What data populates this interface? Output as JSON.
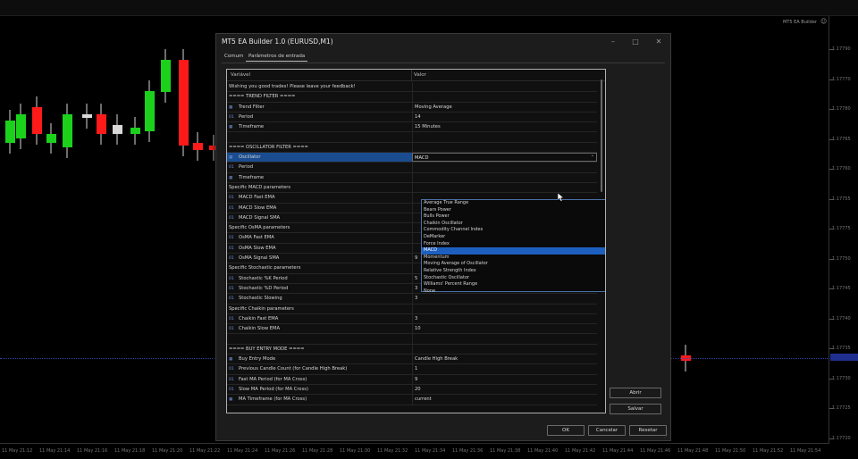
{
  "chart": {
    "label": "MT5 EA Builder",
    "price_ticks": [
      "1.17790",
      "1.17770",
      "1.17780",
      "1.17765",
      "1.17760",
      "1.17755",
      "1.17775",
      "1.17750",
      "1.17745",
      "1.17740",
      "1.17735",
      "1.17730",
      "1.17725",
      "1.17720"
    ],
    "time_ticks": [
      "11 May 21:12",
      "11 May 21:14",
      "11 May 21:16",
      "11 May 21:18",
      "11 May 21:20",
      "11 May 21:22",
      "11 May 21:24",
      "11 May 21:26",
      "11 May 21:28",
      "11 May 21:30",
      "11 May 21:32",
      "11 May 21:34",
      "11 May 21:36",
      "11 May 21:38",
      "11 May 21:40",
      "11 May 21:42",
      "11 May 21:44",
      "11 May 21:46",
      "11 May 21:48",
      "11 May 21:50",
      "11 May 21:52",
      "11 May 21:54"
    ],
    "colors": {
      "bull": "#1cd11c",
      "bear": "#ff1a1a",
      "bid_line": "#3344aa"
    }
  },
  "dialog": {
    "title": "MT5 EA Builder 1.0 (EURUSD,M1)",
    "tabs": [
      "Comum",
      "Parâmetros de entrada"
    ],
    "active_tab": "Parâmetros de entrada",
    "columns": {
      "variable": "Variável",
      "value": "Valor"
    },
    "rows": [
      {
        "name": "Wishing you good trades! Please leave your feedback!",
        "value": "",
        "icon": ""
      },
      {
        "name": "==== TREND FILTER ====",
        "value": "",
        "icon": ""
      },
      {
        "name": "Trend Filter",
        "value": "Moving Average",
        "icon": "enum"
      },
      {
        "name": "Period",
        "value": "14",
        "icon": "01"
      },
      {
        "name": "Timeframe",
        "value": "15 Minutes",
        "icon": "enum"
      },
      {
        "name": "",
        "value": "",
        "icon": ""
      },
      {
        "name": "==== OSCILLATOR FILTER ====",
        "value": "",
        "icon": ""
      },
      {
        "name": "Oscillator",
        "value": "MACD",
        "icon": "enum"
      },
      {
        "name": "Period",
        "value": "",
        "icon": "01"
      },
      {
        "name": "Timeframe",
        "value": "",
        "icon": "enum"
      },
      {
        "name": "Specific MACD parameters",
        "value": "",
        "icon": ""
      },
      {
        "name": "MACD Fast EMA",
        "value": "",
        "icon": "01"
      },
      {
        "name": "MACD Slow EMA",
        "value": "",
        "icon": "01"
      },
      {
        "name": "MACD Signal SMA",
        "value": "",
        "icon": "01"
      },
      {
        "name": "Specific OsMA parameters",
        "value": "",
        "icon": ""
      },
      {
        "name": "OsMA Fast EMA",
        "value": "",
        "icon": "01"
      },
      {
        "name": "OsMA Slow EMA",
        "value": "",
        "icon": "01"
      },
      {
        "name": "OsMA Signal SMA",
        "value": "9",
        "icon": "01"
      },
      {
        "name": "Specific Stochastic parameters",
        "value": "",
        "icon": ""
      },
      {
        "name": "Stochastic %K Period",
        "value": "5",
        "icon": "01"
      },
      {
        "name": "Stochastic %D Period",
        "value": "3",
        "icon": "01"
      },
      {
        "name": "Stochastic Slowing",
        "value": "3",
        "icon": "01"
      },
      {
        "name": "Specific Chaikin parameters",
        "value": "",
        "icon": ""
      },
      {
        "name": "Chaikin Fast EMA",
        "value": "3",
        "icon": "01"
      },
      {
        "name": "Chaikin Slow EMA",
        "value": "10",
        "icon": "01"
      },
      {
        "name": "",
        "value": "",
        "icon": ""
      },
      {
        "name": "==== BUY ENTRY MODE ====",
        "value": "",
        "icon": ""
      },
      {
        "name": "Buy Entry Mode",
        "value": "Candle High Break",
        "icon": "enum"
      },
      {
        "name": "Previous Candle Count (for Candle High Break)",
        "value": "1",
        "icon": "01"
      },
      {
        "name": "Fast MA Period (for MA Cross)",
        "value": "9",
        "icon": "01"
      },
      {
        "name": "Slow MA Period (for MA Cross)",
        "value": "20",
        "icon": "01"
      },
      {
        "name": "MA Timeframe (for MA Cross)",
        "value": "current",
        "icon": "enum"
      }
    ],
    "dropdown": {
      "options": [
        "Average True Range",
        "Bears Power",
        "Bulls Power",
        "Chaikin Oscillator",
        "Commodity Channel Index",
        "DeMarker",
        "Force Index",
        "MACD",
        "Momentum",
        "Moving Average of Oscillator",
        "Relative Strength Index",
        "Stochastic Oscillator",
        "Williams' Percent Range",
        "None"
      ],
      "selected": "MACD"
    },
    "buttons": {
      "open": "Abrir",
      "save": "Salvar",
      "ok": "OK",
      "cancel": "Cancelar",
      "reset": "Resetar"
    }
  }
}
